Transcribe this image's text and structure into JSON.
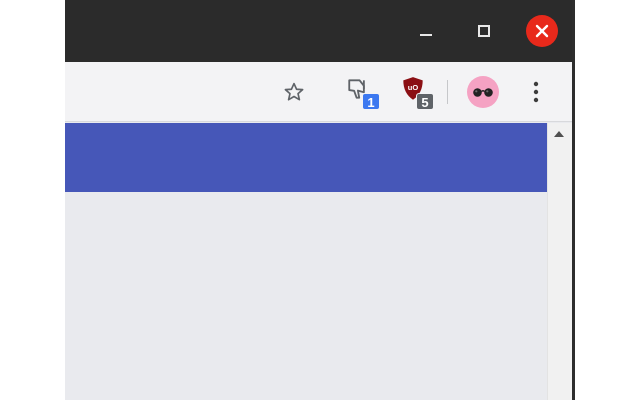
{
  "window_controls": {
    "minimize": "minimize-icon",
    "maximize": "maximize-icon",
    "close": "close-icon"
  },
  "toolbar": {
    "bookmark_icon": "star-icon",
    "extensions": [
      {
        "icon": "thumbs-down-icon",
        "badge": "1",
        "badge_color": "#3c78f0"
      },
      {
        "icon": "shield-icon",
        "badge": "5",
        "badge_color": "#5f6368"
      }
    ],
    "profile_icon": "glasses-avatar-icon",
    "menu_icon": "vertical-dots-icon"
  },
  "page": {
    "header_color": "#4657b8",
    "background_color": "#e9eaee"
  },
  "colors": {
    "titlebar": "#2b2b2b",
    "close_button": "#e8291b",
    "toolbar": "#f3f3f5",
    "avatar": "#f5a2c3",
    "ublock_red": "#8b0f14"
  }
}
